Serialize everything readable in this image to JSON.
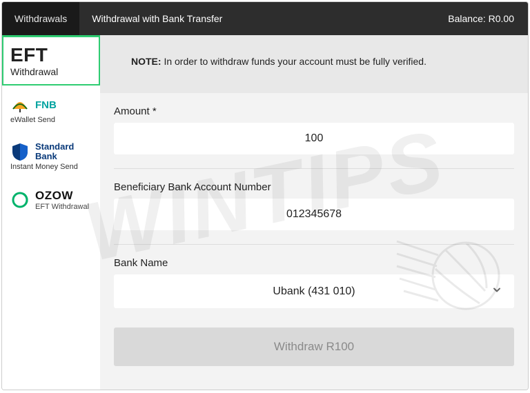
{
  "header": {
    "tab_withdrawals": "Withdrawals",
    "title": "Withdrawal with Bank Transfer",
    "balance_label": "Balance: R0.00"
  },
  "sidebar": {
    "items": [
      {
        "title": "EFT",
        "sub": "Withdrawal"
      },
      {
        "title": "FNB",
        "sub": "eWallet Send"
      },
      {
        "title": "Standard Bank",
        "sub": "Instant Money Send"
      },
      {
        "title": "OZOW",
        "sub": "EFT Withdrawal"
      }
    ]
  },
  "notice": {
    "prefix": "NOTE:",
    "text": " In order to withdraw funds your account must be fully verified."
  },
  "form": {
    "amount_label": "Amount *",
    "amount_value": "100",
    "account_label": "Beneficiary Bank Account Number",
    "account_value": "012345678",
    "bank_label": "Bank Name",
    "bank_value": "Ubank (431 010)",
    "submit_label": "Withdraw R100"
  },
  "watermark": "WINTIPS"
}
